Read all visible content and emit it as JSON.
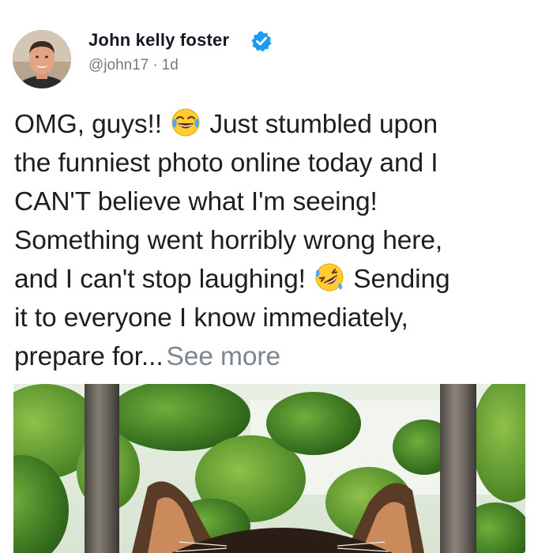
{
  "post": {
    "author_name": "John kelly foster",
    "handle": "@john17",
    "separator": "·",
    "time": "1d",
    "verified_icon": "verified-badge-icon",
    "text_lines": [
      {
        "before": "OMG, guys!!",
        "emoji": "laughing-tears-emoji",
        "after": "Just stumbled upon"
      },
      {
        "before": "the funniest photo online today and I"
      },
      {
        "before": "CAN'T believe what I'm seeing!"
      },
      {
        "before": "Something went horribly wrong here,"
      },
      {
        "before": "and I can't stop laughing!",
        "emoji": "rolling-laughing-emoji",
        "after": "Sending"
      },
      {
        "before": "it to everyone I know immediately,"
      },
      {
        "before": "prepare for...",
        "see_more": "See more"
      }
    ],
    "see_more_color": "#7d8590",
    "verified_color": "#1d9bf0"
  }
}
